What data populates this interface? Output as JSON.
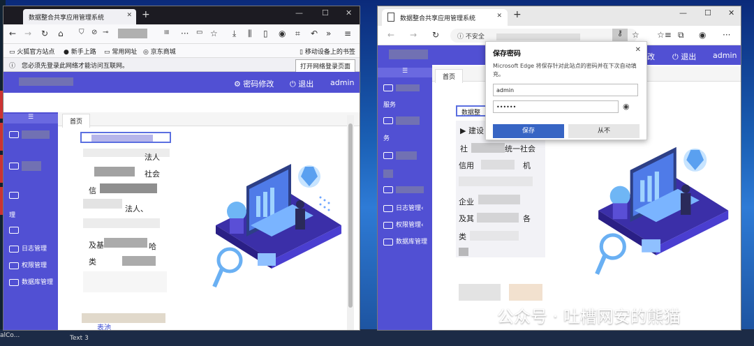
{
  "desktop": {
    "left_labels": [
      "Co",
      "alCo..."
    ],
    "taskbar_text": "Text 3"
  },
  "win1": {
    "tab_title": "数据整合共享应用管理系统",
    "tab_close": "✕",
    "new_tab": "+",
    "window_controls": {
      "min": "—",
      "max": "☐",
      "close": "✕"
    },
    "nav_icons": {
      "back": "←",
      "forward": "→",
      "reload": "↻",
      "home": "⌂",
      "star": "☆",
      "menu": "≡",
      "more": "···",
      "download": "⤓",
      "library": "⫼",
      "sidebar": "▯",
      "account": "◉",
      "crop": "⌗",
      "undo": "↶",
      "overflow": "»"
    },
    "bookmarks": [
      "火狐官方站点",
      "新手上路",
      "常用网址",
      "京东商城"
    ],
    "bookmarks_right": "移动设备上的书签",
    "notice_text": "您必须先登录此网络才能访问互联网。",
    "notice_button": "打开网络登录页面",
    "header": {
      "password": "密码修改",
      "logout": "退出",
      "user": "admin",
      "password_icon": "gear-icon",
      "logout_icon": "power-icon"
    },
    "sidebar_items": [
      "",
      "",
      "",
      "日志管理",
      "权限管理",
      "数据库管理"
    ],
    "sidebar_partial": [
      "理"
    ],
    "page_tab": "首页",
    "list_fragments": [
      "法人",
      "社会",
      "信",
      "法人、",
      "及基",
      "哈",
      "类"
    ],
    "bottom_fragment": "表池"
  },
  "win2": {
    "tab_title": "数据整合共享应用管理系统",
    "tab_close": "✕",
    "new_tab": "+",
    "window_controls": {
      "min": "—",
      "max": "☐",
      "close": "✕"
    },
    "nav_icons": {
      "back": "←",
      "forward": "→",
      "reload": "↻",
      "info": "ⓘ",
      "star": "☆",
      "collections": "☆≡",
      "tabs": "⧉",
      "profile": "◉",
      "more": "···"
    },
    "address_text": "不安全",
    "header": {
      "logout": "退出",
      "user": "admin",
      "password_suffix": "改"
    },
    "sidebar_items": [
      "日志管理‹",
      "权限管理‹",
      "数据库管理"
    ],
    "sidebar_fragments": [
      "服务",
      "务"
    ],
    "page_tab": "首页",
    "list_fragments": [
      "▶ 建设",
      "社",
      "统一社会",
      "信用",
      "机",
      "企业",
      "及其",
      "各",
      "类"
    ],
    "list_label": "数据整",
    "popup": {
      "title": "保存密码",
      "description": "Microsoft Edge 将保存针对此站点的密码并在下次自动填充。",
      "username": "admin",
      "password_mask": "••••••",
      "save": "保存",
      "never": "从不",
      "close": "✕",
      "eye_icon": "eye-icon"
    }
  },
  "watermark": "公众号 · 吐槽网安的熊猫"
}
